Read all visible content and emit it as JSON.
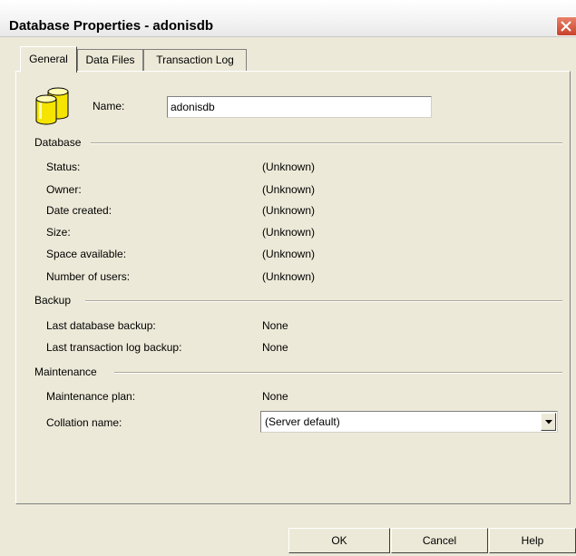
{
  "window": {
    "title": "Database Properties - adonisdb"
  },
  "tabs": [
    {
      "label": "General",
      "active": true
    },
    {
      "label": "Data Files",
      "active": false
    },
    {
      "label": "Transaction Log",
      "active": false
    }
  ],
  "general": {
    "name_label": "Name:",
    "name_value": "adonisdb",
    "database_group": "Database",
    "database_fields": [
      {
        "label": "Status:",
        "value": "(Unknown)"
      },
      {
        "label": "Owner:",
        "value": "(Unknown)"
      },
      {
        "label": "Date created:",
        "value": "(Unknown)"
      },
      {
        "label": "Size:",
        "value": "(Unknown)"
      },
      {
        "label": "Space available:",
        "value": "(Unknown)"
      },
      {
        "label": "Number of users:",
        "value": "(Unknown)"
      }
    ],
    "backup_group": "Backup",
    "backup_fields": [
      {
        "label": "Last database backup:",
        "value": "None"
      },
      {
        "label": "Last transaction log backup:",
        "value": "None"
      }
    ],
    "maintenance_group": "Maintenance",
    "maintenance_plan_label": "Maintenance plan:",
    "maintenance_plan_value": "None",
    "collation_label": "Collation name:",
    "collation_value": "(Server default)"
  },
  "buttons": {
    "ok": "OK",
    "cancel": "Cancel",
    "help": "Help"
  },
  "icons": {
    "database": "database-icon",
    "close": "close-icon",
    "dropdown": "chevron-down-icon"
  },
  "colors": {
    "dialog_bg": "#ece9d8",
    "close_button": "#c9422a",
    "db_icon_yellow": "#f5e400"
  }
}
